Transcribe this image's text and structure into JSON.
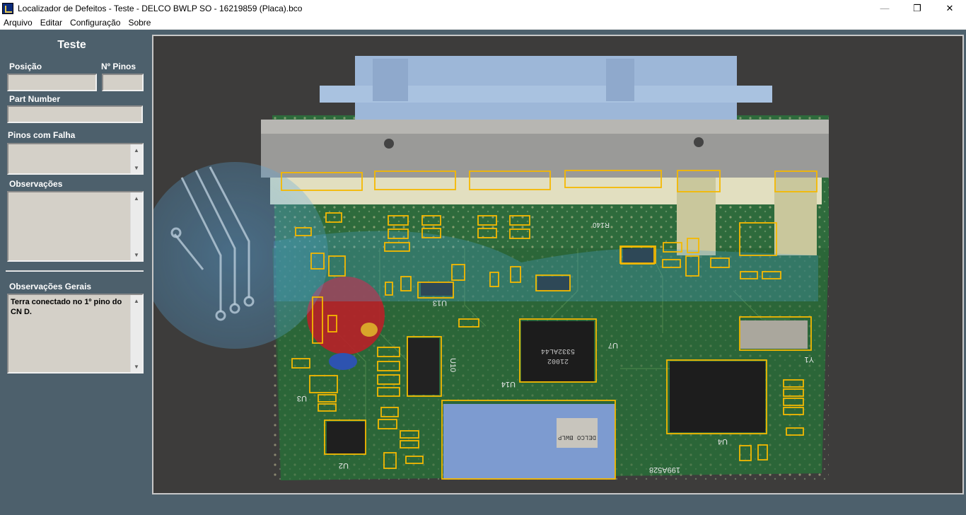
{
  "window": {
    "title": "Localizador de Defeitos - Teste - DELCO BWLP SO - 16219859 (Placa).bco",
    "minimize_icon": "minimize-icon",
    "maximize_icon": "restore-icon",
    "close_icon": "close-icon"
  },
  "menu": {
    "items": [
      "Arquivo",
      "Editar",
      "Configuração",
      "Sobre"
    ]
  },
  "panel": {
    "title": "Teste",
    "posicao_label": "Posição",
    "posicao_value": "",
    "npinos_label": "Nº Pinos",
    "npinos_value": "",
    "partnumber_label": "Part Number",
    "partnumber_value": "",
    "pinos_falha_label": "Pinos com Falha",
    "pinos_falha_value": "",
    "observacoes_label": "Observações",
    "observacoes_value": "",
    "obs_gerais_label": "Observações Gerais",
    "obs_gerais_value": "Terra conectado no 1º pino do CN D."
  },
  "board": {
    "highlight_color": "#f5b800",
    "pcb_color": "#2f6b3a",
    "silkscreen": [
      "U13",
      "U10",
      "U7",
      "U14",
      "U4",
      "U3",
      "U2",
      "Y1",
      "R140",
      "199A528",
      "5332AL44",
      "21002"
    ],
    "chip_marking": "DELCO BWLP"
  }
}
